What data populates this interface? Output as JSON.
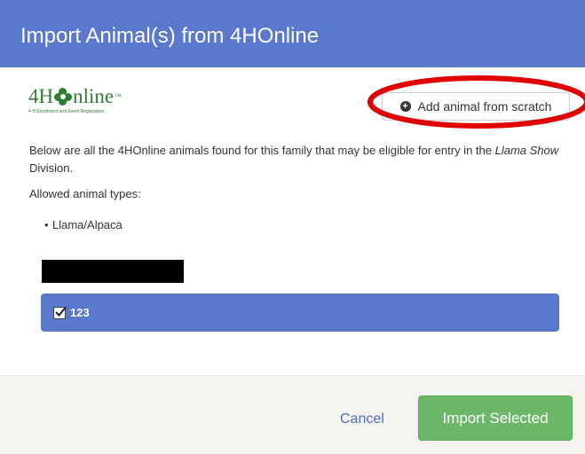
{
  "modal": {
    "title": "Import Animal(s) from 4HOnline"
  },
  "logo": {
    "text_prefix": "4H",
    "text_suffix": "nline",
    "trademark": "™",
    "tagline": "4-H Enrollment and Event Registration"
  },
  "add_button": {
    "label": "Add animal from scratch",
    "icon": "plus-circle-icon"
  },
  "description": {
    "prefix": "Below are all the 4HOnline animals found for this family that may be eligible for entry in the ",
    "division": "Llama Show",
    "suffix": " Division."
  },
  "allowed": {
    "label": "Allowed animal types:",
    "types": [
      "Llama/Alpaca"
    ]
  },
  "animals": [
    {
      "name": "123",
      "checked": true
    }
  ],
  "footer": {
    "cancel_label": "Cancel",
    "import_label": "Import Selected"
  },
  "colors": {
    "header": "#5a78cc",
    "row_selected": "#5a78cc",
    "import_button": "#6bb86b",
    "annotation": "#e00000"
  }
}
